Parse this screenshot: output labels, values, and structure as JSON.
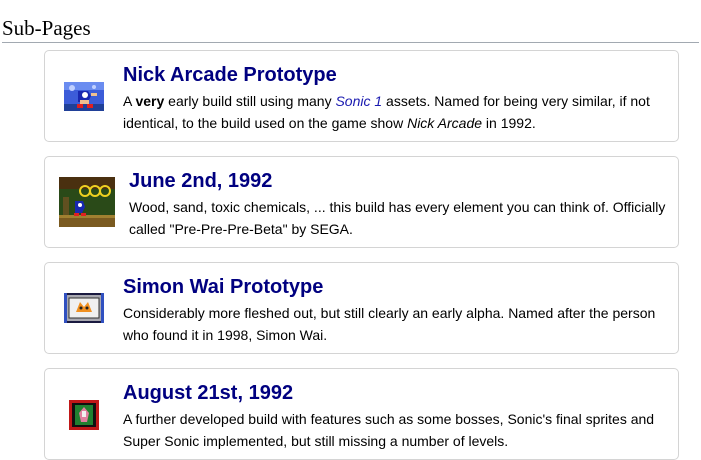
{
  "section": {
    "heading": "Sub-Pages"
  },
  "cards": [
    {
      "title": "Nick Arcade Prototype",
      "desc": {
        "p1": "A ",
        "bold": "very",
        "p2": " early build still using many ",
        "link": "Sonic 1",
        "p3": " assets. Named for being very similar, if not identical, to the build used on the game show ",
        "italic": "Nick Arcade",
        "p4": " in 1992."
      }
    },
    {
      "title": "June 2nd, 1992",
      "desc": "Wood, sand, toxic chemicals, ... this build has every element you can think of. Officially called \"Pre-Pre-Pre-Beta\" by SEGA."
    },
    {
      "title": "Simon Wai Prototype",
      "desc": "Considerably more fleshed out, but still clearly an early alpha. Named after the person who found it in 1998, Simon Wai."
    },
    {
      "title": "August 21st, 1992",
      "desc": "A further developed build with features such as some bosses, Sonic's final sprites and Super Sonic implemented, but still missing a number of levels."
    }
  ]
}
